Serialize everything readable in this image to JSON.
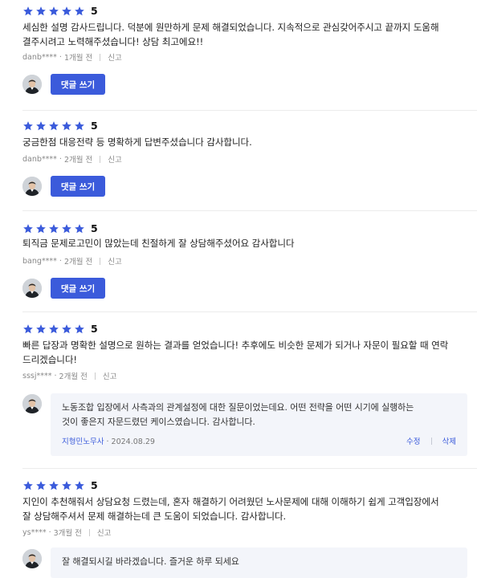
{
  "reviews": [
    {
      "score": "5",
      "stars": 5,
      "lines": [
        "세심한 설명 감사드립니다. 덕분에 원만하게 문제 해결되었습니다. 지속적으로 관심갖어주시고 끝까지 도움해",
        "결주시려고 노력해주셨습니다! 상담 최고에요!!"
      ],
      "author": "danb****",
      "time": "1개월 전",
      "report": "신고",
      "comment_button": "댓글 쓰기"
    },
    {
      "score": "5",
      "stars": 5,
      "lines": [
        "궁금한점 대응전략 등 명확하게 답변주셨습니다 감사합니다."
      ],
      "author": "danb****",
      "time": "2개월 전",
      "report": "신고",
      "comment_button": "댓글 쓰기"
    },
    {
      "score": "5",
      "stars": 5,
      "lines": [
        "퇴직금 문제로고민이 많았는데 친절하게 잘 상담해주셨어요 감사합니다"
      ],
      "author": "bang****",
      "time": "2개월 전",
      "report": "신고",
      "comment_button": "댓글 쓰기"
    },
    {
      "score": "5",
      "stars": 5,
      "lines": [
        "빠른 답장과 명확한 설명으로 원하는 결과를 얻었습니다! 추후에도 비슷한 문제가 되거나 자문이 필요할 때 연락",
        "드리겠습니다!"
      ],
      "author": "sssj****",
      "time": "2개월 전",
      "report": "신고",
      "reply": {
        "lines": [
          "노동조합 입장에서 사측과의 관계설정에 대한 질문이었는데요. 어떤 전략을 어떤 시기에 실행하는",
          "것이 좋은지 자문드렸던 케이스였습니다. 감사합니다."
        ],
        "author": "지형민노무사",
        "date": "2024.08.29",
        "edit": "수정",
        "delete": "삭제"
      }
    },
    {
      "score": "5",
      "stars": 5,
      "lines": [
        "지인이 추천해줘서 상담요청 드렸는데, 혼자 해결하기 어려웠던 노사문제에 대해 이해하기 쉽게 고객입장에서",
        "잘 상담해주셔서 문제 해결하는데 큰 도움이 되었습니다. 감사합니다."
      ],
      "author": "ys****",
      "time": "3개월 전",
      "report": "신고",
      "reply": {
        "lines": [
          "잘 해결되시길 바라겠습니다. 즐거운 하루 되세요"
        ]
      }
    }
  ],
  "colors": {
    "star": "#3b5bdb",
    "button": "#3b5bdb",
    "reply_background": "#f3f5fa",
    "meta_text": "#888888",
    "divider": "#ececec"
  },
  "icons": {
    "star": "star-icon",
    "avatar": "avatar"
  }
}
